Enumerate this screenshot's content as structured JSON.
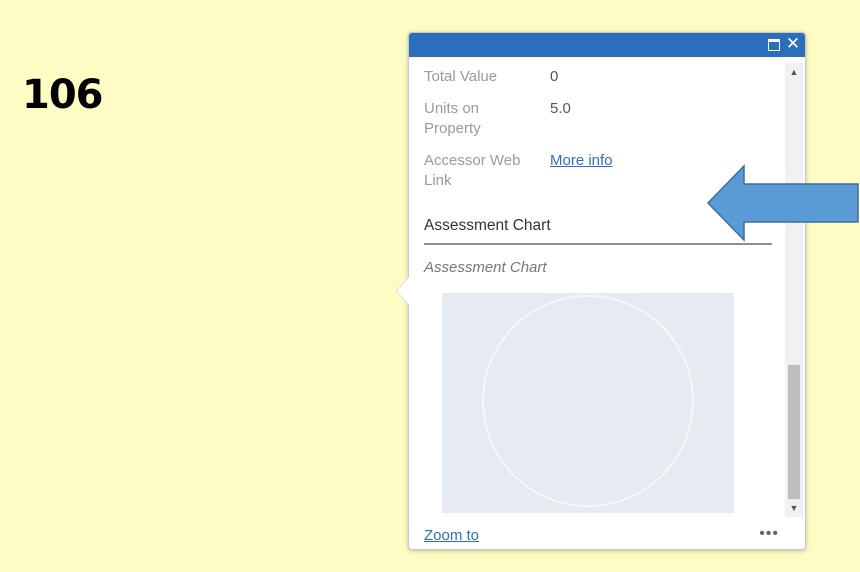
{
  "slide": {
    "number": "106"
  },
  "popup": {
    "attributes": [
      {
        "label": "Total Value",
        "value": "0"
      },
      {
        "label": "Units on Property",
        "value": "5.0"
      },
      {
        "label": "Accessor Web Link",
        "value": "More info"
      }
    ],
    "section_title": "Assessment Chart",
    "chart_caption": "Assessment Chart",
    "footer": {
      "zoom_label": "Zoom to",
      "more_label": "•••"
    },
    "title_bar": {
      "maximize_icon": "maximize-icon",
      "close_icon": "close-icon",
      "close_glyph": "✕"
    },
    "scrollbar": {
      "up_glyph": "▲",
      "down_glyph": "▼"
    }
  },
  "colors": {
    "background": "#fffbc4",
    "title_bar": "#2b6fba",
    "link": "#2e6fc1",
    "arrow": "#5b9bd5"
  }
}
